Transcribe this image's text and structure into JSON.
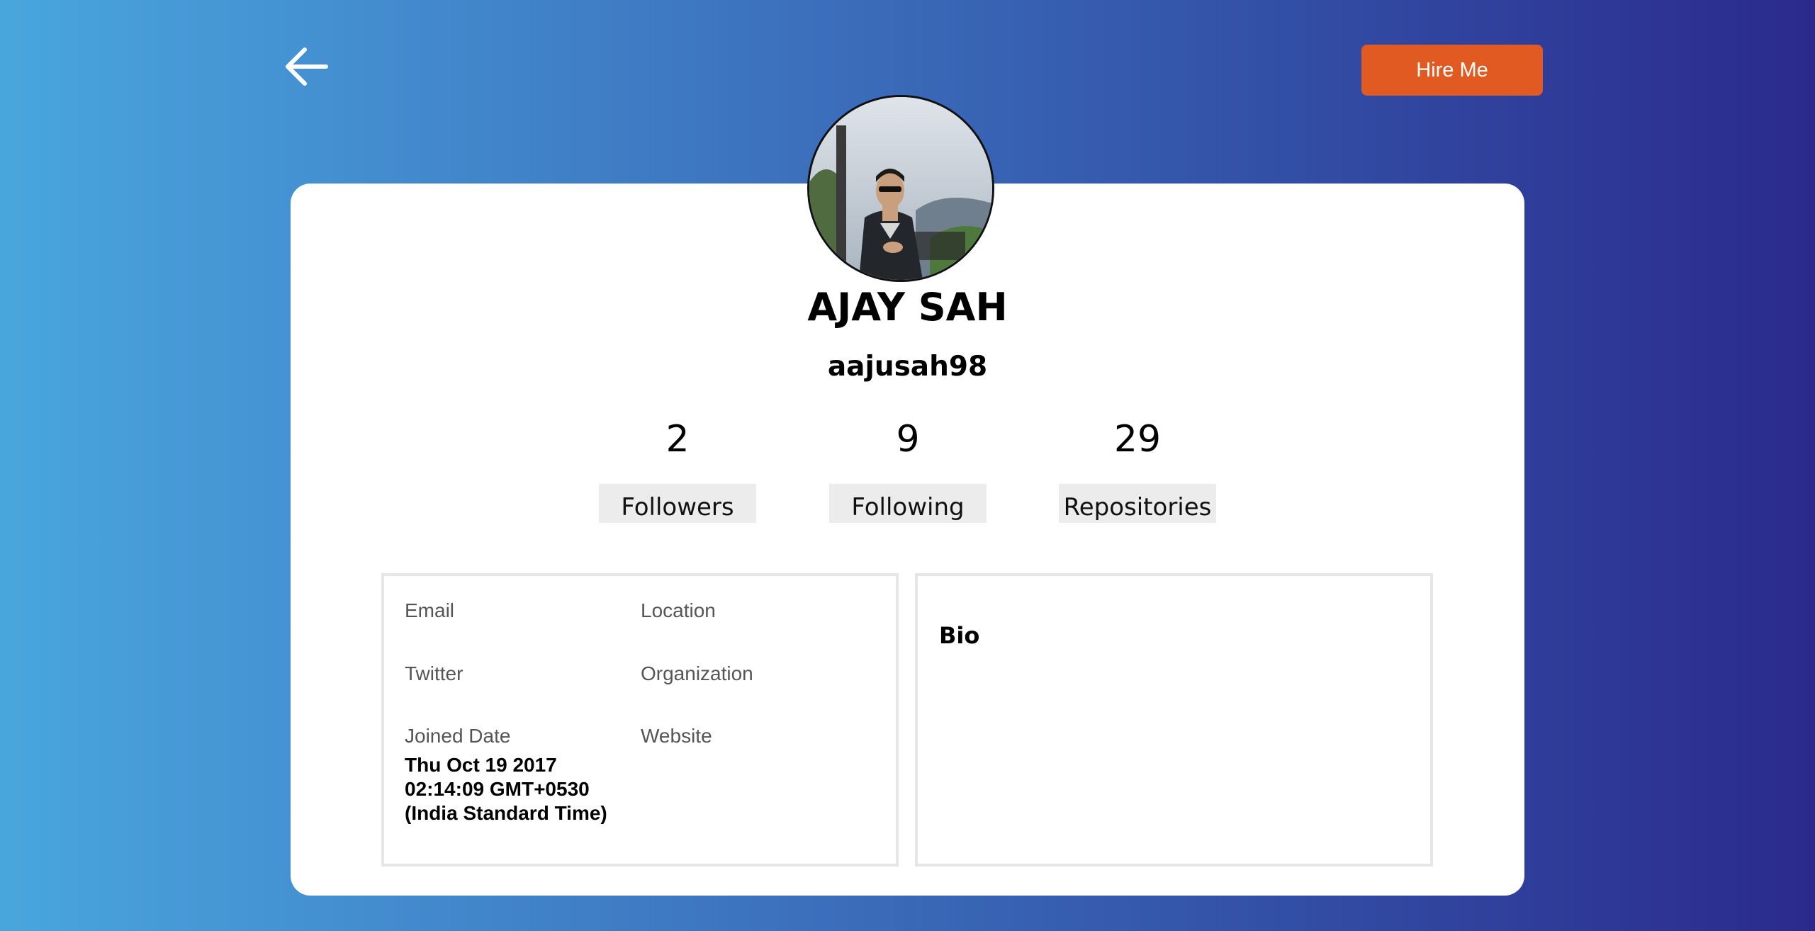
{
  "header": {
    "back_icon": "arrow-left-icon",
    "hire_label": "Hire Me"
  },
  "profile": {
    "name": "AJAY SAH",
    "username": "aajusah98",
    "avatar_icon": "profile-photo"
  },
  "stats": [
    {
      "count": "2",
      "label": "Followers"
    },
    {
      "count": "9",
      "label": "Following"
    },
    {
      "count": "29",
      "label": "Repositories"
    }
  ],
  "details": {
    "email_label": "Email",
    "location_label": "Location",
    "twitter_label": "Twitter",
    "organization_label": "Organization",
    "joined_label": "Joined Date",
    "joined_value": "Thu Oct 19 2017 02:14:09 GMT+0530 (India Standard Time)",
    "website_label": "Website"
  },
  "bio": {
    "title": "Bio"
  },
  "colors": {
    "accent": "#e05a22",
    "gradient_start": "#49a6dd",
    "gradient_end": "#2b2a8c"
  }
}
